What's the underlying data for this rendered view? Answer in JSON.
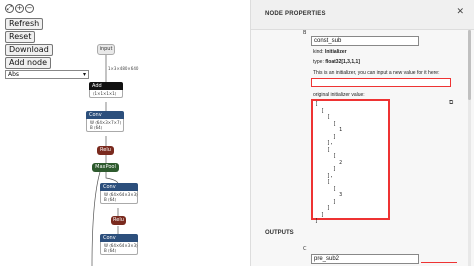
{
  "canvas": {
    "zoom_icons": [
      "⤢",
      "+",
      "−"
    ],
    "buttons": {
      "refresh": "Refresh",
      "reset": "Reset",
      "download": "Download",
      "add_node": "Add node"
    },
    "op_select": {
      "selected": "Abs"
    }
  },
  "graph": {
    "input_label": "input",
    "input_shape": "1×3×480×640",
    "add_label": "Add",
    "add_shape": "⟨1×1×1×1⟩",
    "conv1": {
      "label": "Conv",
      "w": "W ⟨64×3×7×7⟩",
      "b": "B ⟨64⟩"
    },
    "relu1": "Relu",
    "maxpool": "MaxPool",
    "conv2": {
      "label": "Conv",
      "w": "W ⟨64×64×3×3⟩",
      "b": "B ⟨64⟩"
    },
    "relu2": "Relu",
    "conv3": {
      "label": "Conv",
      "w": "W ⟨64×64×3×3⟩",
      "b": "B ⟨64⟩"
    },
    "colors": {
      "input": "#e8e8e8",
      "add": "#111111",
      "conv": "#2c4f7c",
      "relu": "#7a2a1e",
      "maxpool": "#2d5a2d"
    }
  },
  "panel": {
    "title": "NODE PROPERTIES",
    "close_icon": "close-icon",
    "inputs": {
      "b_index": "B",
      "name_value": "const_sub",
      "kind_label": "kind:",
      "kind_value": "Initializer",
      "type_label": "type:",
      "type_value": "float32[1,3,1,1]",
      "hint": "This is an initializer, you can input a new value for it here:",
      "new_value": "",
      "orig_label": "original initializer value:",
      "orig_value": "[\n  [\n    [\n      [\n        1\n      ]\n    ],\n    [\n      [\n        2\n      ]\n    ],\n    [\n      [\n        3\n      ]\n    ]\n  ]\n]"
    },
    "outputs": {
      "title": "OUTPUTS",
      "c_index": "C",
      "name_value": "pre_sub2"
    },
    "accent_color": "#e33333"
  }
}
